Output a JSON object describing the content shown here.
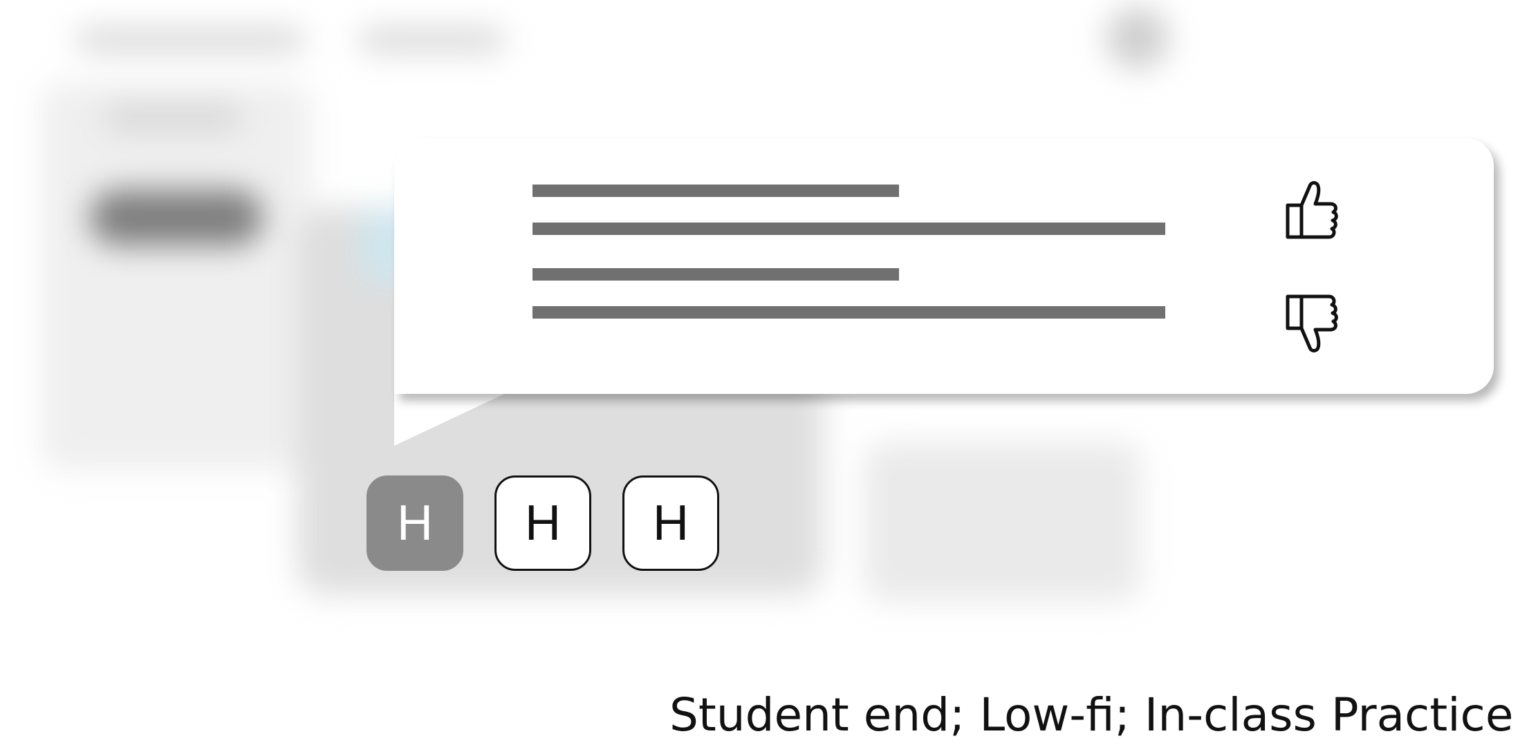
{
  "feedback_popup": {
    "thumbs_up_icon": "thumbs-up-icon",
    "thumbs_down_icon": "thumbs-down-icon",
    "text_line_color": "#707070"
  },
  "hint_buttons": [
    {
      "label": "H",
      "selected": true
    },
    {
      "label": "H",
      "selected": false
    },
    {
      "label": "H",
      "selected": false
    }
  ],
  "colors": {
    "selected_button": "#8a8a8a",
    "outline": "#111111"
  },
  "caption": "Student end; Low-fi; In-class Practice"
}
